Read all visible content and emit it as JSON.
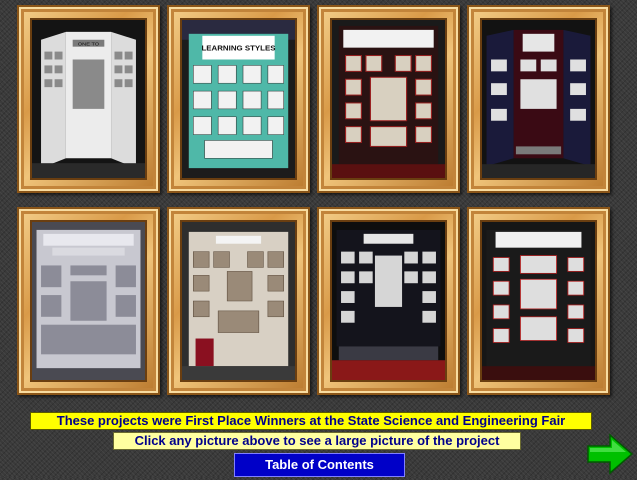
{
  "gallery": {
    "projects": [
      {
        "label": "ONE TO"
      },
      {
        "label": "LEARNING STYLES"
      },
      {
        "label": ""
      },
      {
        "label": ""
      },
      {
        "label": ""
      },
      {
        "label": ""
      },
      {
        "label": ""
      },
      {
        "label": ""
      }
    ]
  },
  "footer": {
    "banner": "These projects were First Place Winners at the State Science and Engineering Fair",
    "hint": "Click any picture above to see a large picture of the project",
    "toc_label": "Table of Contents"
  },
  "icons": {
    "next": "green-right-arrow-icon"
  },
  "colors": {
    "banner_bg": "#ffff00",
    "hint_bg": "#ffffa0",
    "toc_bg": "#0000c8",
    "text": "#00008b",
    "arrow": "#00c000",
    "frame": "#d99a48"
  }
}
